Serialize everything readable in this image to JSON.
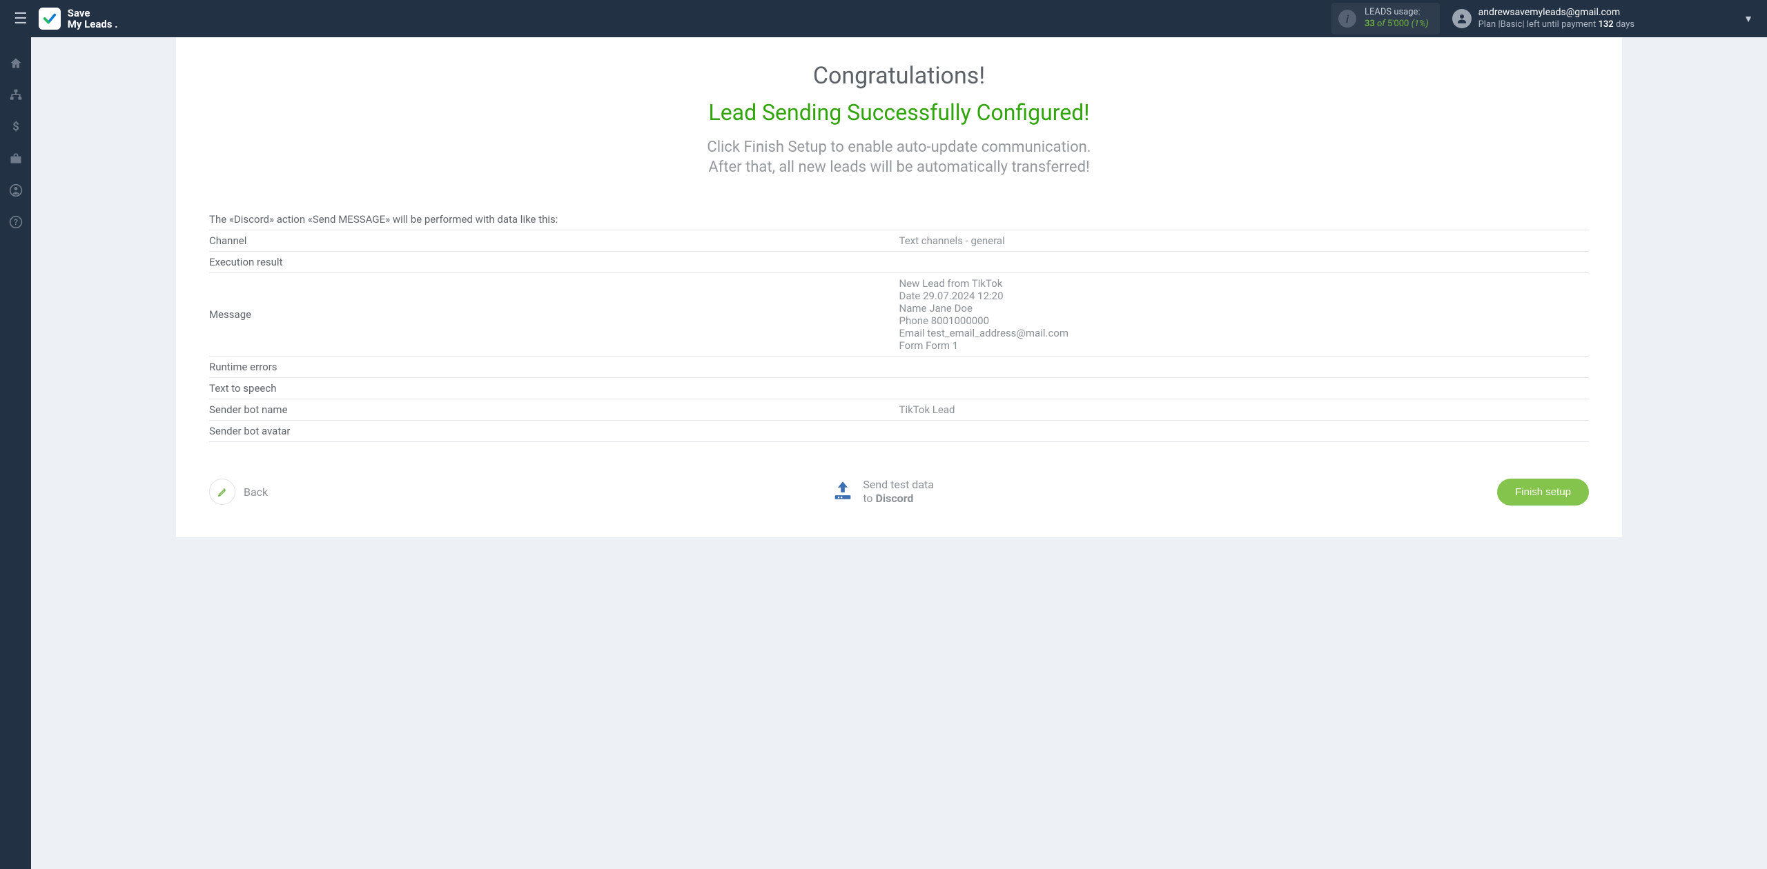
{
  "header": {
    "logo_line1": "Save",
    "logo_line2": "My Leads .",
    "usage_label": "LEADS usage:",
    "usage_current": "33",
    "usage_of": "of",
    "usage_total": "5'000",
    "usage_pct": "(1%)",
    "account_email": "andrewsavemyleads@gmail.com",
    "plan_prefix": "Plan |Basic| left until payment ",
    "plan_days": "132",
    "plan_suffix": " days"
  },
  "content": {
    "congrats": "Congratulations!",
    "success": "Lead Sending Successfully Configured!",
    "sub1": "Click Finish Setup to enable auto-update communication.",
    "sub2": "After that, all new leads will be automatically transferred!",
    "action_desc": "The «Discord» action «Send MESSAGE» will be performed with data like this:",
    "rows": [
      {
        "label": "Channel",
        "value": "Text channels - general"
      },
      {
        "label": "Execution result",
        "value": ""
      },
      {
        "label": "Message",
        "value": "New Lead from TikTok\nDate 29.07.2024 12:20\nName Jane Doe\nPhone 8001000000\nEmail test_email_address@mail.com\nForm Form 1"
      },
      {
        "label": "Runtime errors",
        "value": ""
      },
      {
        "label": "Text to speech",
        "value": ""
      },
      {
        "label": "Sender bot name",
        "value": "TikTok Lead"
      },
      {
        "label": "Sender bot avatar",
        "value": ""
      }
    ]
  },
  "footer": {
    "back": "Back",
    "send_line1": "Send test data",
    "send_to": "to ",
    "send_dest": "Discord",
    "finish": "Finish setup"
  }
}
